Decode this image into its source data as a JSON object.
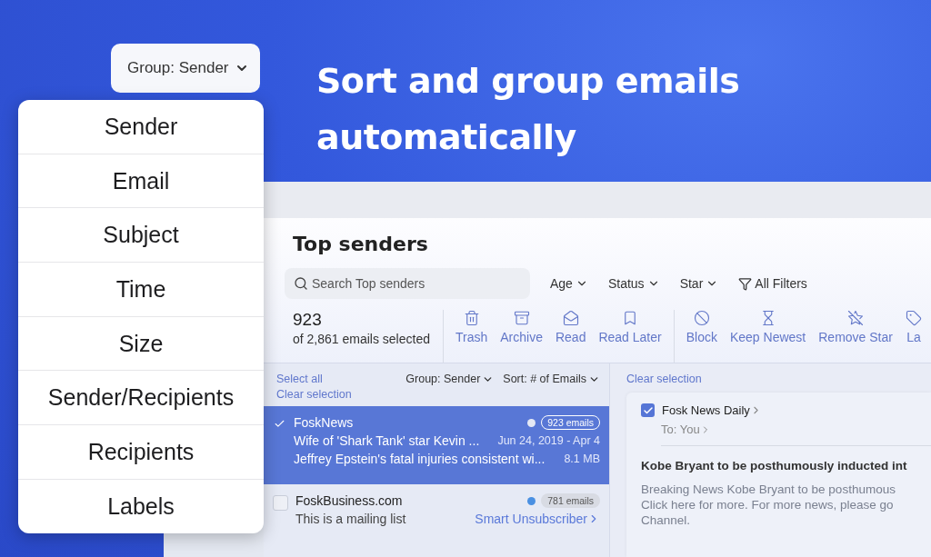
{
  "group_button": {
    "label": "Group: Sender"
  },
  "headline": "Sort and group emails automatically",
  "group_menu": {
    "items": [
      "Sender",
      "Email",
      "Subject",
      "Time",
      "Size",
      "Sender/Recipients",
      "Recipients",
      "Labels"
    ]
  },
  "app": {
    "title": "Top senders",
    "search": {
      "placeholder": "Search Top senders"
    },
    "filters": [
      {
        "label": "Age",
        "kind": "dropdown"
      },
      {
        "label": "Status",
        "kind": "dropdown"
      },
      {
        "label": "Star",
        "kind": "dropdown"
      },
      {
        "label": "All Filters",
        "kind": "filter"
      }
    ],
    "selection": {
      "count": "923",
      "caption": "of 2,861 emails selected"
    },
    "action_groups": [
      [
        "Trash",
        "Archive",
        "Read",
        "Read Later"
      ],
      [
        "Block",
        "Keep Newest",
        "Remove Star",
        "La"
      ]
    ],
    "list": {
      "select_all": "Select all",
      "clear_selection": "Clear selection",
      "group": "Group: Sender",
      "sort": "Sort: # of Emails",
      "rows": [
        {
          "sender": "FoskNews",
          "count": "923 emails",
          "color": "#e4e8f4",
          "line_1": "Wife of 'Shark Tank' star Kevin ...",
          "line_1_meta": "Jun 24, 2019 - Apr 4",
          "line_2": "Jeffrey Epstein's fatal injuries consistent wi...",
          "line_2_meta": "8.1 MB",
          "selected": true
        },
        {
          "sender": "FoskBusiness.com",
          "count": "781 emails",
          "color": "#4a90e2",
          "line_1": "This is a mailing list",
          "link": "Smart Unsubscriber",
          "selected": false
        }
      ]
    },
    "detail": {
      "clear_selection": "Clear selection",
      "sender": "Fosk News Daily",
      "checked": true,
      "to_label": "To:",
      "to": "You",
      "subject": "Kobe Bryant to be posthumously inducted int",
      "body": [
        "Breaking News Kobe Bryant to be posthumous",
        "Click here for more. For more news, please go",
        "Channel."
      ]
    }
  }
}
